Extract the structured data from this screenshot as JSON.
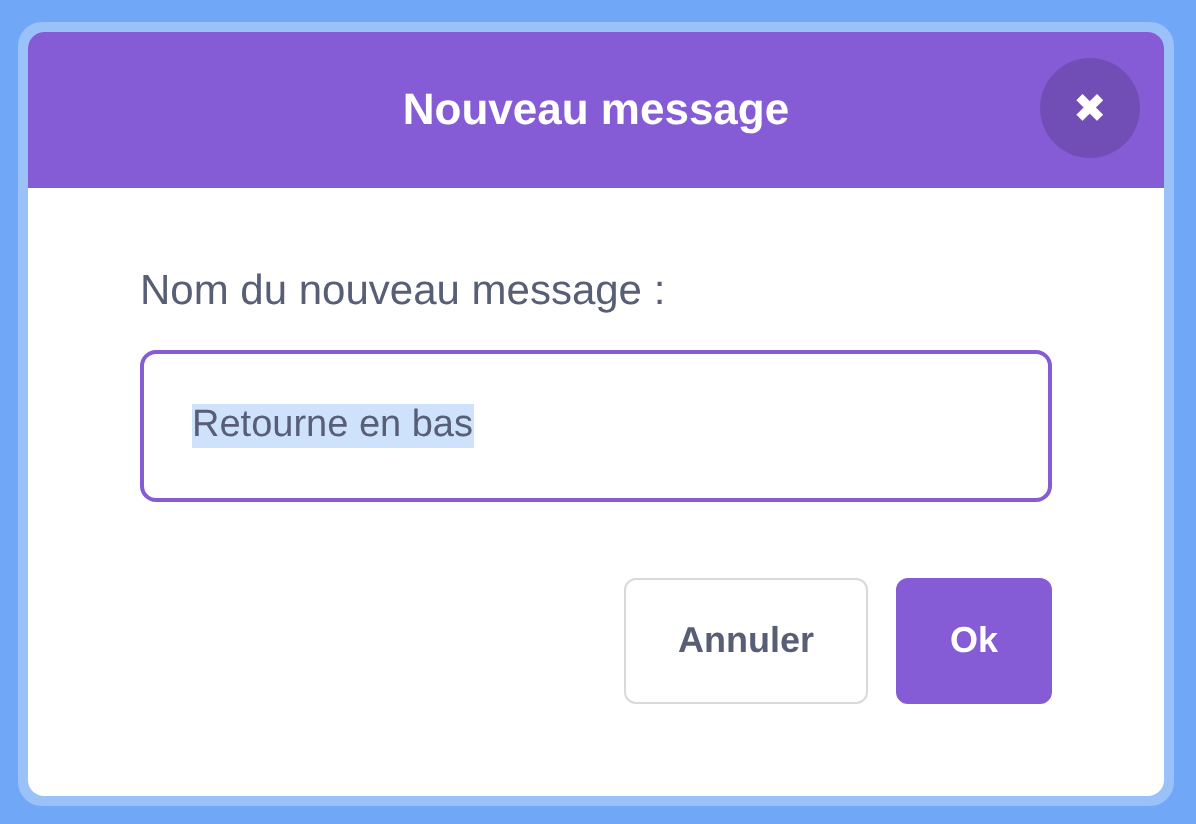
{
  "dialog": {
    "title": "Nouveau message",
    "close_label": "✖"
  },
  "field": {
    "label": "Nom du nouveau message :",
    "value": "Retourne en bas",
    "value_selected": true
  },
  "buttons": [
    {
      "label": "Annuler",
      "kind": "secondary"
    },
    {
      "label": "Ok",
      "kind": "primary"
    }
  ]
}
